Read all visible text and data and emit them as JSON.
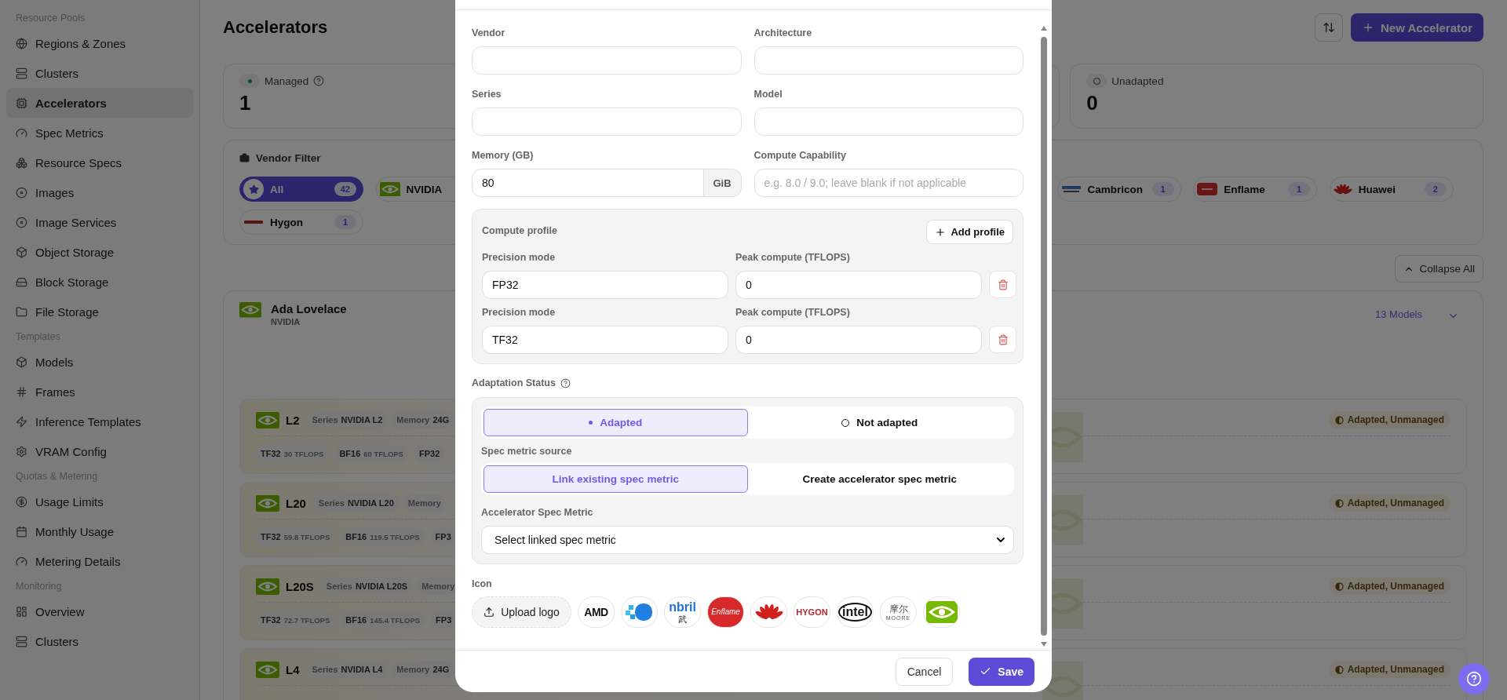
{
  "sidebar": {
    "sections": [
      {
        "title": "Resource Pools",
        "items": [
          {
            "label": "Regions & Zones",
            "selected": false
          },
          {
            "label": "Clusters",
            "selected": false
          },
          {
            "label": "Accelerators",
            "selected": true
          },
          {
            "label": "Spec Metrics",
            "selected": false
          },
          {
            "label": "Resource Specs",
            "selected": false
          },
          {
            "label": "Images",
            "selected": false
          },
          {
            "label": "Image Services",
            "selected": false
          },
          {
            "label": "Object Storage",
            "selected": false
          },
          {
            "label": "Block Storage",
            "selected": false
          },
          {
            "label": "File Storage",
            "selected": false
          }
        ]
      },
      {
        "title": "Templates",
        "items": [
          {
            "label": "Models",
            "selected": false
          },
          {
            "label": "Frames",
            "selected": false
          },
          {
            "label": "Inference Templates",
            "selected": false
          },
          {
            "label": "VRAM Config",
            "selected": false
          }
        ]
      },
      {
        "title": "Quotas & Metering",
        "items": [
          {
            "label": "Usage Limits",
            "selected": false
          },
          {
            "label": "Monthly Usage",
            "selected": false
          },
          {
            "label": "Metering Details",
            "selected": false
          }
        ]
      },
      {
        "title": "Monitoring",
        "items": [
          {
            "label": "Overview",
            "selected": false
          },
          {
            "label": "Clusters",
            "selected": false
          }
        ]
      }
    ]
  },
  "page": {
    "title": "Accelerators",
    "new_button": "New Accelerator"
  },
  "stats": [
    {
      "kind": "managed",
      "label": "Managed",
      "value": "1"
    },
    {
      "kind": "unadapted",
      "label": "Unadapted",
      "value": "0"
    }
  ],
  "vendor_filter": {
    "title": "Vendor Filter",
    "chips": [
      {
        "name": "All",
        "count": "42",
        "kind": "star",
        "selected": true
      },
      {
        "name": "NVIDIA",
        "kind": "nvidia",
        "selected": false
      },
      {
        "name": "Cambricon",
        "count": "1",
        "kind": "cambricon",
        "selected": false
      },
      {
        "name": "Enflame",
        "count": "1",
        "kind": "enflame",
        "selected": false
      },
      {
        "name": "Huawei",
        "count": "2",
        "kind": "huawei",
        "selected": false
      },
      {
        "name": "Hygon",
        "count": "1",
        "kind": "hygon",
        "selected": false
      }
    ]
  },
  "collapse_button": "Collapse All",
  "group": {
    "name": "Ada Lovelace",
    "vendor": "NVIDIA",
    "count": "13 Models",
    "models": [
      {
        "name": "L2",
        "chips": [
          {
            "label": "Series",
            "value": "NVIDIA L2"
          },
          {
            "label": "Memory",
            "value": "24G"
          }
        ],
        "specs": [
          {
            "mode": "TF32",
            "value": "30 TFLOPS"
          },
          {
            "mode": "BF16",
            "value": "60 TFLOPS"
          },
          {
            "mode": "FP32"
          }
        ],
        "status": "Adapted, Unmanaged"
      },
      {
        "name": "L20",
        "chips": [
          {
            "label": "Series",
            "value": "NVIDIA L20"
          },
          {
            "label": "Memory"
          }
        ],
        "specs": [
          {
            "mode": "TF32",
            "value": "59.8 TFLOPS"
          },
          {
            "mode": "BF16",
            "value": "119.5 TFLOPS"
          },
          {
            "mode": "FP3"
          }
        ],
        "status": "Adapted, Unmanaged"
      },
      {
        "name": "L20S",
        "chips": [
          {
            "label": "Series",
            "value": "NVIDIA L20S"
          },
          {
            "label": "Memory"
          }
        ],
        "specs": [
          {
            "mode": "TF32",
            "value": "72.7 TFLOPS"
          },
          {
            "mode": "BF16",
            "value": "145.4 TFLOPS"
          },
          {
            "mode": "FP3"
          }
        ],
        "status": "Adapted, Unmanaged"
      },
      {
        "name": "L4",
        "chips": [
          {
            "label": "Series",
            "value": "NVIDIA L4"
          },
          {
            "label": "Memory",
            "value": "24G"
          }
        ],
        "status": "Adapted, Unmanaged"
      }
    ]
  },
  "modal": {
    "fields": [
      {
        "label": "Vendor"
      },
      {
        "label": "Architecture"
      },
      {
        "label": "Series"
      },
      {
        "label": "Model"
      },
      {
        "label": "Memory (GB)",
        "value": "80",
        "unit": "GiB"
      },
      {
        "label": "Compute Capability",
        "placeholder": "e.g. 8.0 / 9.0; leave blank if not applicable"
      }
    ],
    "compute_profile": {
      "title": "Compute profile",
      "add_button": "Add profile",
      "rows": [
        {
          "mode_label": "Precision mode",
          "mode": "FP32",
          "peak_label": "Peak compute (TFLOPS)",
          "peak": "0"
        },
        {
          "mode_label": "Precision mode",
          "mode": "TF32",
          "peak_label": "Peak compute (TFLOPS)",
          "peak": "0"
        }
      ]
    },
    "adaptation": {
      "label": "Adaptation Status",
      "options": [
        {
          "label": "Adapted",
          "selected": true
        },
        {
          "label": "Not adapted",
          "selected": false
        }
      ],
      "source_label": "Spec metric source",
      "sources": [
        {
          "label": "Link existing spec metric",
          "selected": true
        },
        {
          "label": "Create accelerator spec metric",
          "selected": false
        }
      ],
      "metric_label": "Accelerator Spec Metric",
      "metric_select": "Select linked spec metric"
    },
    "icon": {
      "label": "Icon",
      "upload": "Upload logo",
      "logos": [
        {
          "kind": "amd",
          "text": "AMD"
        },
        {
          "kind": "pixel"
        },
        {
          "kind": "iluvatar",
          "text": "nbril",
          "sub": "武"
        },
        {
          "kind": "enflame",
          "text": "Enflame"
        },
        {
          "kind": "huawei"
        },
        {
          "kind": "hygon",
          "text": "HYGON"
        },
        {
          "kind": "intel",
          "text": "intel"
        },
        {
          "kind": "moore",
          "text": "摩尔",
          "sub": "MOORE"
        },
        {
          "kind": "nvidia"
        }
      ]
    },
    "cancel": "Cancel",
    "save": "Save"
  }
}
